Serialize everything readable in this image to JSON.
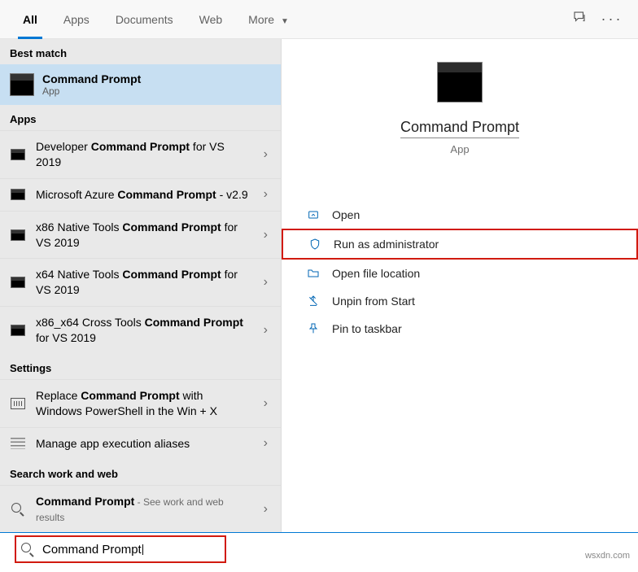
{
  "tabs": {
    "all": "All",
    "apps": "Apps",
    "documents": "Documents",
    "web": "Web",
    "more": "More"
  },
  "sections": {
    "best_match": "Best match",
    "apps": "Apps",
    "settings": "Settings",
    "work_web": "Search work and web"
  },
  "best": {
    "title": "Command Prompt",
    "sub": "App"
  },
  "apps_list": [
    {
      "pre": "Developer ",
      "bold": "Command Prompt",
      "post": " for VS 2019"
    },
    {
      "pre": "Microsoft Azure ",
      "bold": "Command Prompt",
      "post": " - v2.9"
    },
    {
      "pre": "x86 Native Tools ",
      "bold": "Command Prompt",
      "post": " for VS 2019"
    },
    {
      "pre": "x64 Native Tools ",
      "bold": "Command Prompt",
      "post": " for VS 2019"
    },
    {
      "pre": "x86_x64 Cross Tools ",
      "bold": "Command Prompt",
      "post": " for VS 2019"
    }
  ],
  "settings_list": {
    "replace_pre": "Replace ",
    "replace_bold": "Command Prompt",
    "replace_post": " with Windows PowerShell in the Win + X",
    "aliases": "Manage app execution aliases"
  },
  "web_list": {
    "title_bold": "Command Prompt",
    "hint": " - See work and web results"
  },
  "preview": {
    "title": "Command Prompt",
    "sub": "App"
  },
  "actions": {
    "open": "Open",
    "run_admin": "Run as administrator",
    "file_loc": "Open file location",
    "unpin_start": "Unpin from Start",
    "pin_taskbar": "Pin to taskbar"
  },
  "search": {
    "value": "Command Prompt"
  },
  "watermark": "wsxdn.com"
}
